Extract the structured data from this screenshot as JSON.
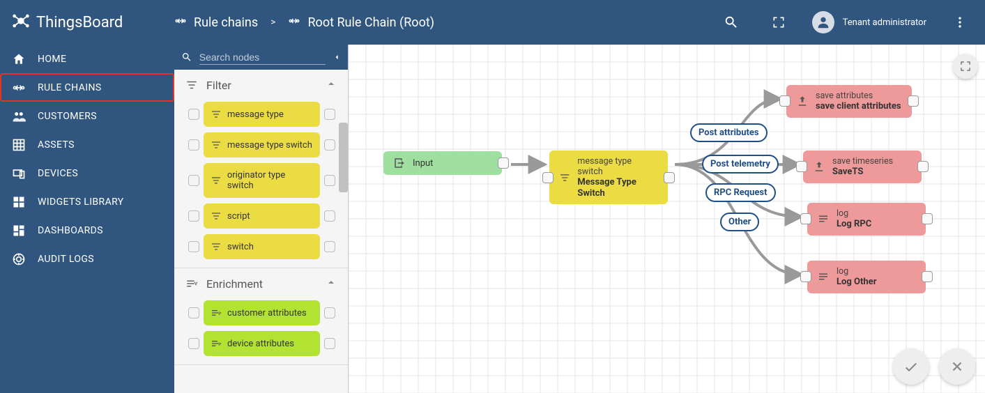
{
  "brand": "ThingsBoard",
  "breadcrumb": {
    "root_label": "Rule chains",
    "sep": ">",
    "current_label": "Root Rule Chain (Root)"
  },
  "user_role": "Tenant administrator",
  "sidebar": {
    "items": [
      {
        "label": "HOME"
      },
      {
        "label": "RULE CHAINS"
      },
      {
        "label": "CUSTOMERS"
      },
      {
        "label": "ASSETS"
      },
      {
        "label": "DEVICES"
      },
      {
        "label": "WIDGETS LIBRARY"
      },
      {
        "label": "DASHBOARDS"
      },
      {
        "label": "AUDIT LOGS"
      }
    ],
    "active_index": 1
  },
  "search": {
    "placeholder": "Search nodes"
  },
  "categories": {
    "filter": {
      "title": "Filter",
      "nodes": [
        {
          "label": "message type"
        },
        {
          "label": "message type switch"
        },
        {
          "label": "originator type switch"
        },
        {
          "label": "script"
        },
        {
          "label": "switch"
        }
      ]
    },
    "enrichment": {
      "title": "Enrichment",
      "nodes": [
        {
          "label": "customer attributes"
        },
        {
          "label": "device attributes"
        }
      ]
    }
  },
  "canvas": {
    "nodes": {
      "input": {
        "label": "Input"
      },
      "switch": {
        "type_label": "message type switch",
        "name_label": "Message Type Switch"
      },
      "save_attr": {
        "type_label": "save attributes",
        "name_label": "save client attributes"
      },
      "save_ts": {
        "type_label": "save timeseries",
        "name_label": "SaveTS"
      },
      "log_rpc": {
        "type_label": "log",
        "name_label": "Log RPC"
      },
      "log_other": {
        "type_label": "log",
        "name_label": "Log Other"
      }
    },
    "edge_labels": {
      "post_attributes": "Post attributes",
      "post_telemetry": "Post telemetry",
      "rpc_request": "RPC Request",
      "other": "Other"
    }
  }
}
